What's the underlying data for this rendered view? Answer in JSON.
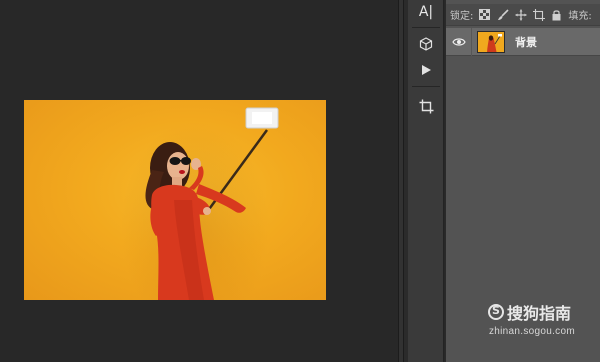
{
  "tool_strip": {
    "items": [
      {
        "name": "character-panel",
        "icon": "character-text-icon",
        "glyph": "A|"
      },
      {
        "name": "3d-panel",
        "icon": "cube-3d-icon"
      },
      {
        "name": "play-action",
        "icon": "play-icon"
      },
      {
        "name": "crop-tool",
        "icon": "crop-icon"
      }
    ]
  },
  "layers_panel": {
    "lock_label": "锁定:",
    "fill_label": "填充:",
    "lock_icons": [
      "transparency-checker-icon",
      "brush-icon",
      "move-arrows-icon",
      "artboard-icon",
      "lock-icon"
    ],
    "layer": {
      "name": "背景",
      "visible": true
    }
  },
  "document": {
    "description_icon": "selfie-photo-thumbnail"
  },
  "watermark": {
    "logo_symbol": "S",
    "logo_text": "搜狗指南",
    "url": "zhinan.sogou.com"
  },
  "colors": {
    "canvas_bg": "#282828",
    "panel_bg": "#535353",
    "selected_layer": "#696969",
    "photo_yellow": "#f2a91e",
    "dress_red": "#d8391e"
  }
}
